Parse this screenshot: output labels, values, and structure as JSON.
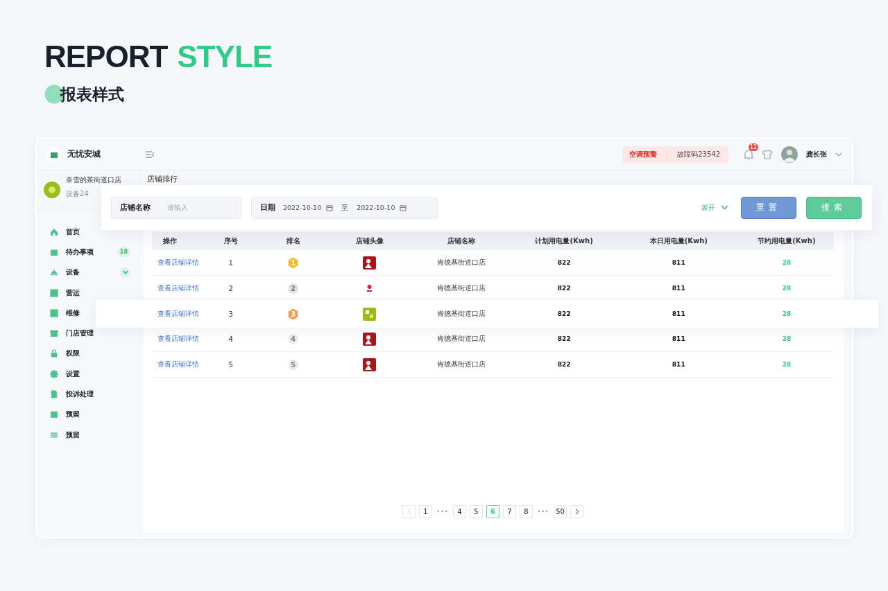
{
  "page_title": [
    {
      "text": "REPORT",
      "color": "#16212c"
    },
    {
      "text": "STYLE",
      "color": "#2ecc85"
    }
  ],
  "page_subtitle": "报表样式",
  "app": {
    "name": "无忧安城",
    "alert": {
      "label": "空调预警",
      "detail": "故障码23542"
    },
    "notifications": "12",
    "user": "龚长张"
  },
  "store": {
    "name": "奈雪的茶街道口店",
    "devices": "设备24"
  },
  "menu": [
    {
      "label": "首页",
      "kind": "plain"
    },
    {
      "label": "待办事项",
      "kind": "badge",
      "badge": "18"
    },
    {
      "label": "设备",
      "kind": "expand",
      "expanded": false
    },
    {
      "label": "营运",
      "kind": "plain"
    },
    {
      "label": "维修",
      "kind": "plain"
    },
    {
      "label": "门店管理",
      "kind": "plain"
    },
    {
      "label": "权限",
      "kind": "plain"
    },
    {
      "label": "设置",
      "kind": "plain"
    },
    {
      "label": "投诉处理",
      "kind": "plain"
    },
    {
      "label": "预留",
      "kind": "plain"
    },
    {
      "label": "预留",
      "kind": "plain"
    }
  ],
  "section_title": "店铺排行",
  "filters": {
    "store_name": {
      "label": "店铺名称",
      "placeholder": "请输入"
    },
    "date": {
      "label": "日期",
      "from": "2022-10-10",
      "separator": "至",
      "to": "2022-10-10"
    },
    "expand": "展开",
    "buttons": [
      {
        "label": "重置",
        "kind": "reset"
      },
      {
        "label": "搜索",
        "kind": "search"
      }
    ]
  },
  "table": {
    "columns": [
      "操作",
      "序号",
      "排名",
      "店铺头像",
      "店铺名称",
      "计划用电量(Kwh)",
      "本日用电量(Kwh)",
      "节约用电量(Kwh)"
    ],
    "rows": [
      {
        "action": "查看店铺详情",
        "index": "1",
        "rank": {
          "text": "1",
          "color": "#f8b92c"
        },
        "avatar": {
          "kind": "red"
        },
        "name": "肯德基街道口店",
        "planned": "822",
        "today": "811",
        "saved": "28",
        "highlighted": false
      },
      {
        "action": "查看店铺详情",
        "index": "2",
        "rank": {
          "text": "2",
          "color": "#dfe1e8"
        },
        "avatar": {
          "kind": "white"
        },
        "name": "肯德基街道口店",
        "planned": "822",
        "today": "811",
        "saved": "28",
        "highlighted": false
      },
      {
        "action": "查看店铺详情",
        "index": "3",
        "rank": {
          "text": "3",
          "color": "#f59b4f"
        },
        "avatar": {
          "kind": "green"
        },
        "name": "肯德基街道口店",
        "planned": "822",
        "today": "811",
        "saved": "28",
        "highlighted": true
      },
      {
        "action": "查看店铺详情",
        "index": "4",
        "rank": {
          "text": "4",
          "color": "#e9eaee"
        },
        "avatar": {
          "kind": "red"
        },
        "name": "肯德基街道口店",
        "planned": "822",
        "today": "811",
        "saved": "28",
        "highlighted": false
      },
      {
        "action": "查看店铺详情",
        "index": "5",
        "rank": {
          "text": "5",
          "color": "#e9eaee"
        },
        "avatar": {
          "kind": "red"
        },
        "name": "肯德基街道口店",
        "planned": "822",
        "today": "811",
        "saved": "28",
        "highlighted": false
      }
    ]
  },
  "pagination": [
    {
      "label": "1",
      "kind": "page",
      "selected": false
    },
    {
      "label": "•••",
      "kind": "ellipsis"
    },
    {
      "label": "4",
      "kind": "page",
      "selected": false
    },
    {
      "label": "5",
      "kind": "page",
      "selected": false
    },
    {
      "label": "6",
      "kind": "page",
      "selected": true
    },
    {
      "label": "7",
      "kind": "page",
      "selected": false
    },
    {
      "label": "8",
      "kind": "page",
      "selected": false
    },
    {
      "label": "•••",
      "kind": "ellipsis"
    },
    {
      "label": "50",
      "kind": "page",
      "selected": false
    }
  ]
}
